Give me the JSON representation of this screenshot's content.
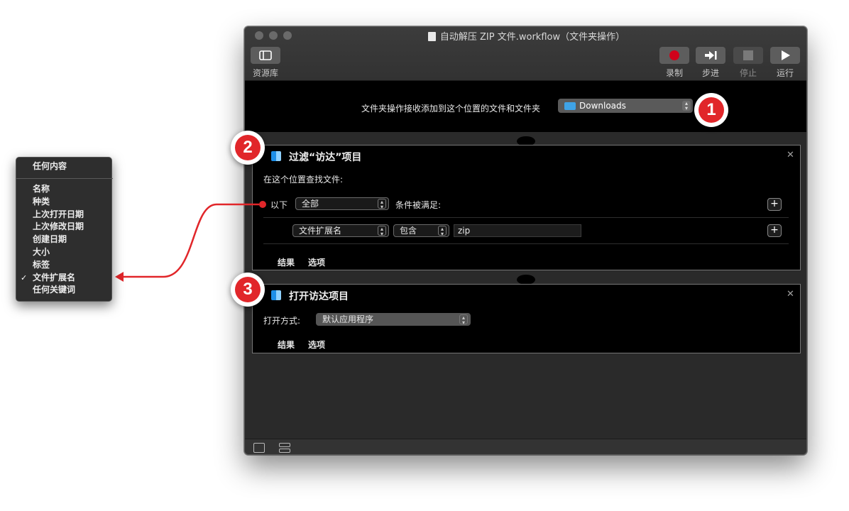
{
  "window": {
    "title": "自动解压 ZIP 文件.workflow（文件夹操作）",
    "toolbar": {
      "library_label": "资源库",
      "record_label": "录制",
      "step_label": "步进",
      "stop_label": "停止",
      "run_label": "运行"
    }
  },
  "header": {
    "text": "文件夹操作接收添加到这个位置的文件和文件夹",
    "folder": "Downloads"
  },
  "filter_action": {
    "title": "过滤“访达”项目",
    "find_label": "在这个位置查找文件:",
    "prefix": "以下",
    "scope": "全部",
    "suffix": "条件被满足:",
    "criterion": "文件扩展名",
    "operator": "包含",
    "value": "zip",
    "tab_results": "结果",
    "tab_options": "选项"
  },
  "open_action": {
    "title": "打开访达项目",
    "open_with_label": "打开方式:",
    "open_with_value": "默认应用程序",
    "tab_results": "结果",
    "tab_options": "选项"
  },
  "menu": {
    "items": [
      "任何内容",
      "名称",
      "种类",
      "上次打开日期",
      "上次修改日期",
      "创建日期",
      "大小",
      "标签",
      "文件扩展名",
      "任何关键词"
    ],
    "checked": "文件扩展名"
  },
  "badges": [
    "1",
    "2",
    "3"
  ],
  "colors": {
    "annotation_red": "#e1262a",
    "record_red": "#d0021b",
    "finder_blue": "#1d8fe8"
  },
  "icons": [
    "document-icon",
    "sidebar-icon",
    "record-icon",
    "step-icon",
    "stop-icon",
    "play-icon",
    "folder-icon",
    "finder-icon",
    "close-icon",
    "plus-icon",
    "list-view-icon",
    "flow-view-icon",
    "checkmark-icon"
  ]
}
